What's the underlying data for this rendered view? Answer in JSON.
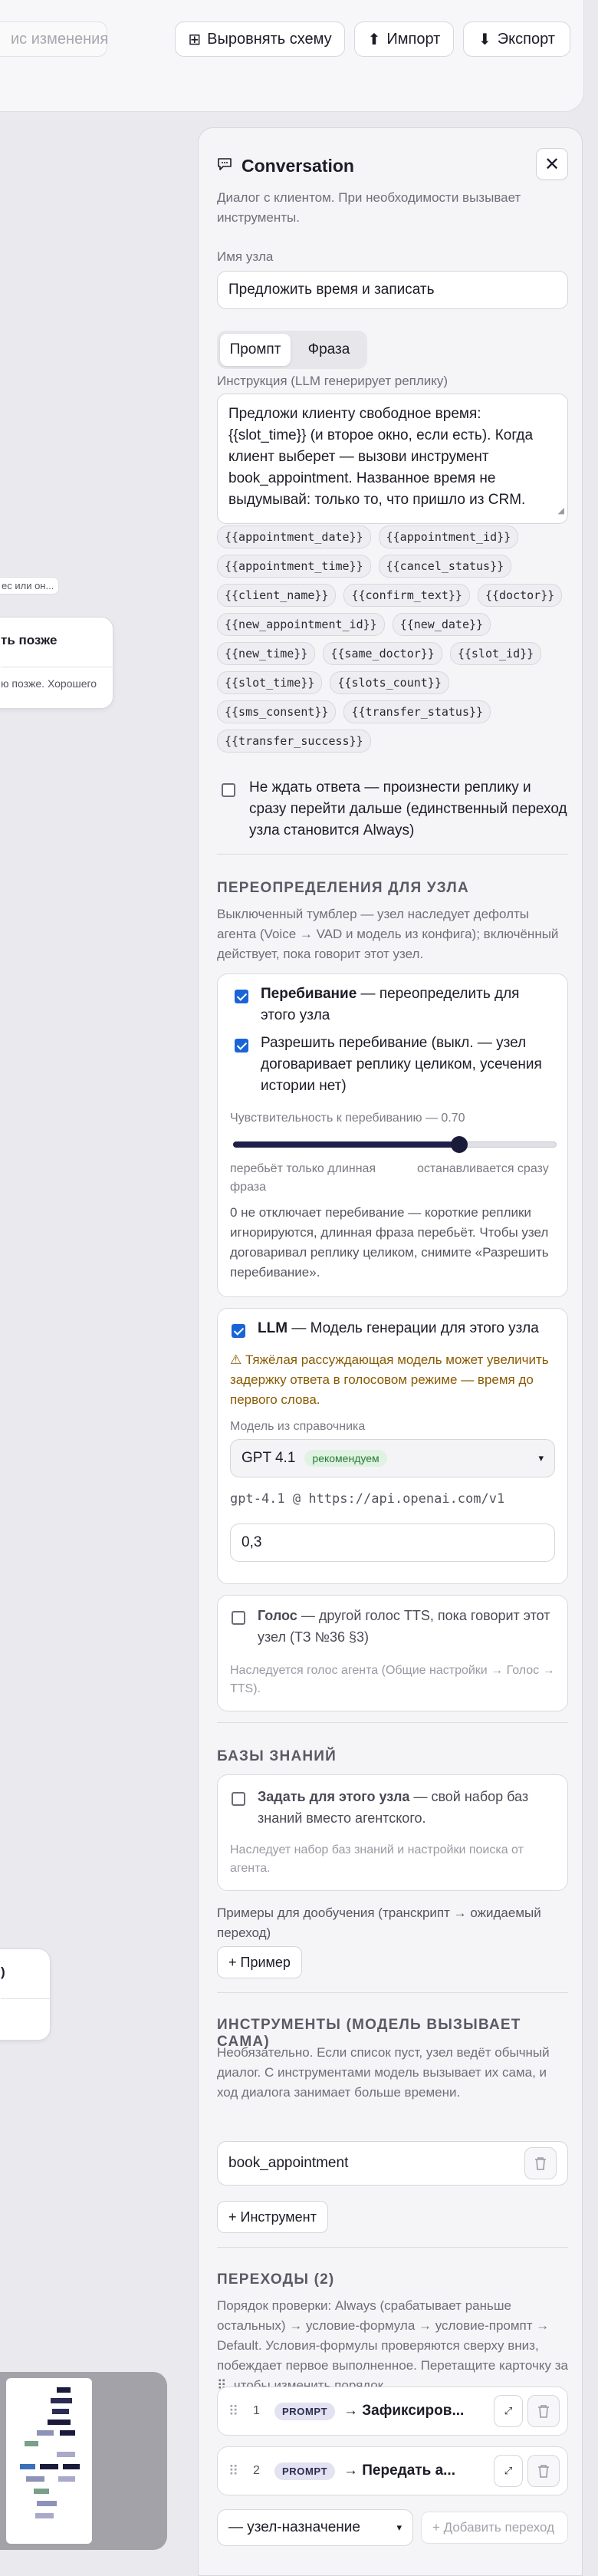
{
  "toolbar": {
    "changes_label": "ис изменения",
    "align_label": "Выровнять схему",
    "import_label": "Импорт",
    "export_label": "Экспорт"
  },
  "canvas": {
    "snippet_top": "ес или он...",
    "node_later_title": "ть позже",
    "node_later_text": "ю позже. Хорошего",
    "node_bottom_title": ")"
  },
  "panel": {
    "title": "Conversation",
    "description": "Диалог с клиентом. При необходимости вызывает инструменты.",
    "node_name_label": "Имя узла",
    "node_name_value": "Предложить время и записать",
    "tabs": [
      "Промпт",
      "Фраза"
    ],
    "instruction_label": "Инструкция (LLM генерирует реплику)",
    "instruction_text": "Предложи клиенту свободное время: {{slot_time}} (и второе окно, если есть). Когда клиент выберет — вызови инструмент book_appointment. Названное время не выдумывай: только то, что пришло из CRM.",
    "variables": [
      "{{appointment_date}}",
      "{{appointment_id}}",
      "{{appointment_time}}",
      "{{cancel_status}}",
      "{{client_name}}",
      "{{confirm_text}}",
      "{{doctor}}",
      "{{new_appointment_id}}",
      "{{new_date}}",
      "{{new_time}}",
      "{{same_doctor}}",
      "{{slot_id}}",
      "{{slot_time}}",
      "{{slots_count}}",
      "{{sms_consent}}",
      "{{transfer_status}}",
      "{{transfer_success}}"
    ],
    "no_wait_label": "Не ждать ответа — произнести реплику и сразу перейти дальше (единственный переход узла становится Always)",
    "overrides": {
      "title": "ПЕРЕОПРЕДЕЛЕНИЯ ДЛЯ УЗЛА",
      "description": "Выключенный тумблер — узел наследует дефолты агента (Voice → VAD и модель из конфига); включённый действует, пока говорит этот узел.",
      "interrupt_bold": "Перебивание",
      "interrupt_rest": " — переопределить для этого узла",
      "allow_interrupt": "Разрешить перебивание (выкл. — узел договаривает реплику целиком, усечения истории нет)",
      "sensitivity_label": "Чувствительность к перебиванию — 0.70",
      "sensitivity_value": 0.7,
      "slider_left": "перебьёт только длинная фраза",
      "slider_right": "останавливается сразу",
      "interrupt_note": "0 не отключает перебивание — короткие реплики игнорируются, длинная фраза перебьёт. Чтобы узел договаривал реплику целиком, снимите «Разрешить перебивание».",
      "llm_bold": "LLM",
      "llm_rest": " — Модель генерации для этого узла",
      "llm_warning": "⚠ Тяжёлая рассуждающая модель может увеличить задержку ответа в голосовом режиме — время до первого слова.",
      "model_label": "Модель из справочника",
      "model_value": "GPT 4.1",
      "model_badge": "рекомендуем",
      "model_endpoint": "gpt-4.1 @ https://api.openai.com/v1",
      "temperature": "0,3",
      "voice_bold": "Голос",
      "voice_rest": " — другой голос TTS, пока говорит этот узел (ТЗ №36 §3)",
      "voice_note": "Наследуется голос агента (Общие настройки → Голос → TTS)."
    },
    "knowledge": {
      "title": "БАЗЫ ЗНАНИЙ",
      "own_bold": "Задать для этого узла",
      "own_rest": " — свой набор баз знаний вместо агентского.",
      "note": "Наследует набор баз знаний и настройки поиска от агента."
    },
    "examples": {
      "label": "Примеры для дообучения (транскрипт → ожидаемый переход)",
      "add_button": "+ Пример"
    },
    "tools": {
      "title": "ИНСТРУМЕНТЫ (МОДЕЛЬ ВЫЗЫВАЕТ САМА)",
      "description": "Необязательно. Если список пуст, узел ведёт обычный диалог. С инструментами модель вызывает их сама, и ход диалога занимает больше времени.",
      "items": [
        "book_appointment"
      ],
      "add_button": "+ Инструмент"
    },
    "transitions": {
      "title": "ПЕРЕХОДЫ (2)",
      "description": "Порядок проверки: Always (срабатывает раньше остальных) → условие-формула → условие-промпт → Default. Условия-формулы проверяются сверху вниз, побеждает первое выполненное. Перетащите карточку за ⠿, чтобы изменить порядок.",
      "items": [
        {
          "num": "1",
          "badge": "PROMPT",
          "target": "→ Зафиксиров..."
        },
        {
          "num": "2",
          "badge": "PROMPT",
          "target": "→ Передать а..."
        }
      ],
      "target_select": "— узел-назначение",
      "add_button": "+ Добавить переход"
    }
  },
  "colors": {
    "accent": "#1a64d8",
    "slider_fill": "#1f1f4a",
    "warning": "#8a5a00"
  }
}
